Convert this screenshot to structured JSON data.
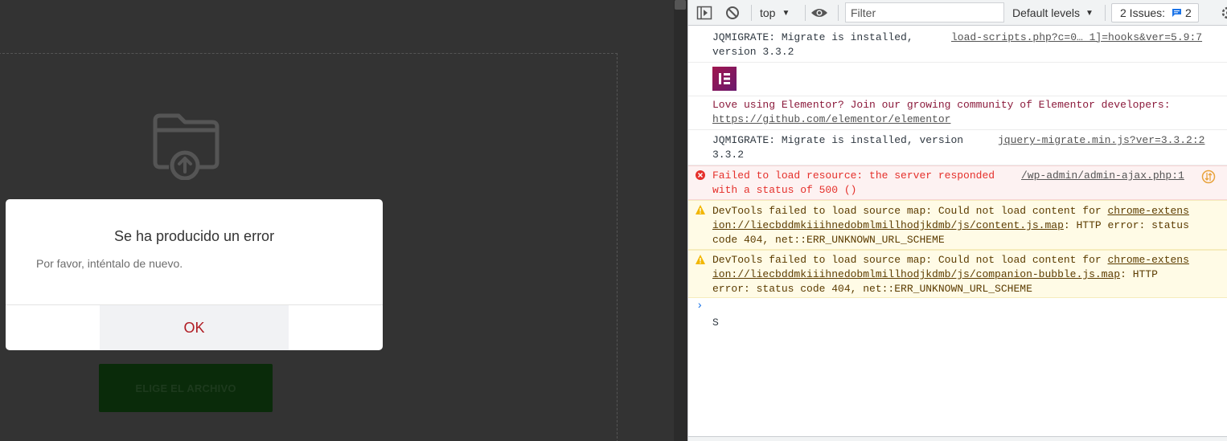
{
  "page": {
    "choose_file_label": "ELIGE EL ARCHIVO"
  },
  "modal": {
    "title": "Se ha producido un error",
    "message": "Por favor, inténtalo de nuevo.",
    "ok_label": "OK"
  },
  "devtools": {
    "toolbar": {
      "context": "top",
      "filter_placeholder": "Filter",
      "levels": "Default levels",
      "issues_label": "2 Issues:",
      "issues_count": "2"
    },
    "messages": {
      "m1": {
        "line1": "JQMIGRATE: Migrate is installed,",
        "line2": "version 3.3.2",
        "source": "load-scripts.php?c=0…_1]=hooks&ver=5.9:7"
      },
      "m2": {
        "logo": "Elementor logo"
      },
      "m3": {
        "line1": "Love using Elementor? Join our growing community of Elementor developers:",
        "link": "https://github.com/elementor/elementor"
      },
      "m4": {
        "line1": "JQMIGRATE: Migrate is installed, version",
        "line2": "3.3.2",
        "source": "jquery-migrate.min.js?ver=3.3.2:2"
      },
      "m5": {
        "line1": "Failed to load resource: the server responded",
        "line2": "with a status of 500 ()",
        "source": "/wp-admin/admin-ajax.php:1"
      },
      "m6": {
        "line1a": "DevTools failed to load source map: Could not load content for ",
        "link1": "chrome-extens",
        "link2": "ion://liecbddmkiiihnedobmlmillhodjkdmb/js/content.js.map",
        "line2b": ": HTTP error: status",
        "line3": "code 404, net::ERR_UNKNOWN_URL_SCHEME"
      },
      "m7": {
        "line1a": "DevTools failed to load source map: Could not load content for ",
        "link1": "chrome-extens",
        "link2": "ion://liecbddmkiiihnedobmlmillhodjkdmb/js/companion-bubble.js.map",
        "line2b": ": HTTP",
        "line3": "error: status code 404, net::ERR_UNKNOWN_URL_SCHEME"
      }
    },
    "prompt_value": "S"
  },
  "colors": {
    "error_text": "#e5302b",
    "warn_text": "#5c3c00",
    "elementor_logo": "#92003b",
    "ok_text": "#b01b22",
    "prompt_arrow": "#1a73e8"
  }
}
